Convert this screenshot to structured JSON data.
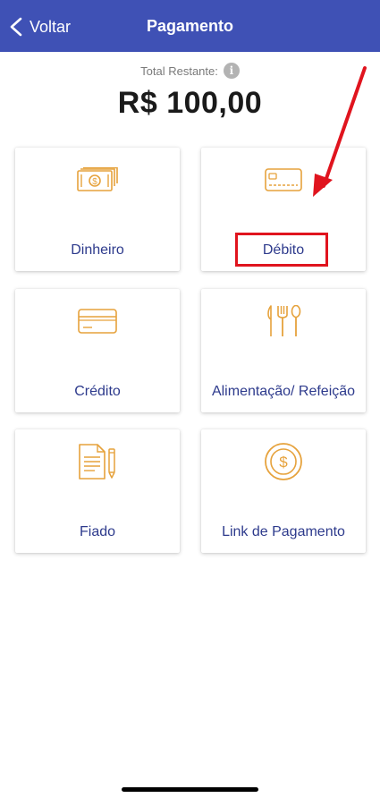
{
  "header": {
    "back_label": "Voltar",
    "title": "Pagamento",
    "bg_color": "#3f51b5"
  },
  "summary": {
    "total_label": "Total Restante:",
    "info_icon_glyph": "i",
    "total_value": "R$ 100,00"
  },
  "payment_options": [
    {
      "label": "Dinheiro",
      "icon": "cash-icon"
    },
    {
      "label": "Débito",
      "icon": "debit-card-icon"
    },
    {
      "label": "Crédito",
      "icon": "credit-card-icon"
    },
    {
      "label": "Alimentação/ Refeição",
      "icon": "cutlery-icon"
    },
    {
      "label": "Fiado",
      "icon": "document-pen-icon"
    },
    {
      "label": "Link de Pagamento",
      "icon": "dollar-coin-icon"
    }
  ],
  "colors": {
    "accent": "#3f51b5",
    "icon": "#e6a23c",
    "label": "#2d3a8c",
    "annotation": "#e0141e"
  }
}
